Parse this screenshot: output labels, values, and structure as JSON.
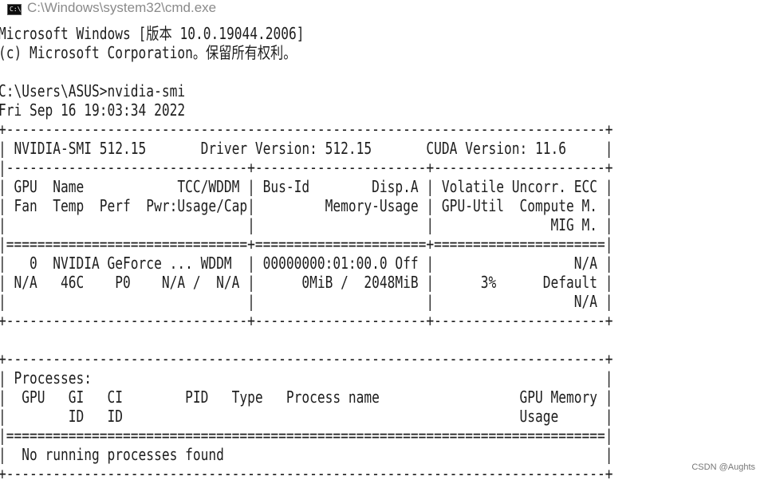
{
  "window": {
    "title": "C:\\Windows\\system32\\cmd.exe",
    "icon": "cmd-icon"
  },
  "console": {
    "text": "Microsoft Windows [版本 10.0.19044.2006]\n(c) Microsoft Corporation。保留所有权利。\n\nC:\\Users\\ASUS>nvidia-smi\nFri Sep 16 19:03:34 2022\n+-----------------------------------------------------------------------------+\n| NVIDIA-SMI 512.15       Driver Version: 512.15       CUDA Version: 11.6     |\n|-------------------------------+----------------------+----------------------+\n| GPU  Name            TCC/WDDM | Bus-Id        Disp.A | Volatile Uncorr. ECC |\n| Fan  Temp  Perf  Pwr:Usage/Cap|         Memory-Usage | GPU-Util  Compute M. |\n|                               |                      |               MIG M. |\n|===============================+======================+======================|\n|   0  NVIDIA GeForce ... WDDM  | 00000000:01:00.0 Off |                  N/A |\n| N/A   46C    P0    N/A /  N/A |      0MiB /  2048MiB |      3%      Default |\n|                               |                      |                  N/A |\n+-------------------------------+----------------------+----------------------+\n\n+-----------------------------------------------------------------------------+\n| Processes:                                                                  |\n|  GPU   GI   CI        PID   Type   Process name                  GPU Memory |\n|        ID   ID                                                   Usage      |\n|=============================================================================|\n|  No running processes found                                                 |\n+-----------------------------------------------------------------------------+"
  },
  "watermark": "CSDN @Aughts"
}
